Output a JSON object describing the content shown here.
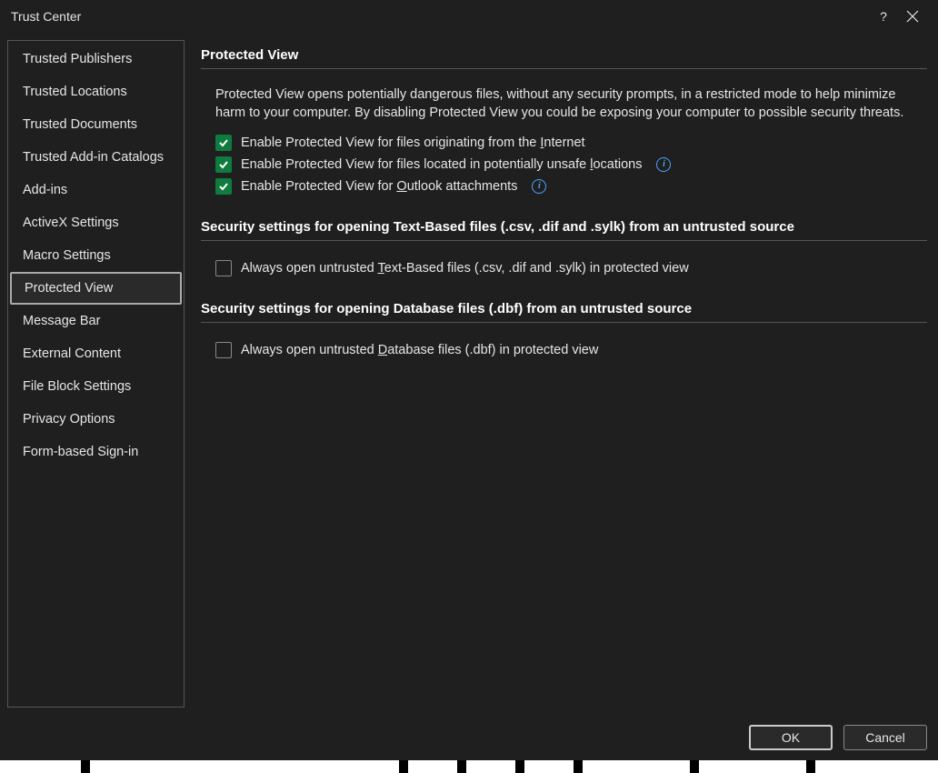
{
  "window": {
    "title": "Trust Center"
  },
  "sidebar": {
    "items": [
      {
        "label": "Trusted Publishers",
        "selected": false
      },
      {
        "label": "Trusted Locations",
        "selected": false
      },
      {
        "label": "Trusted Documents",
        "selected": false
      },
      {
        "label": "Trusted Add-in Catalogs",
        "selected": false
      },
      {
        "label": "Add-ins",
        "selected": false
      },
      {
        "label": "ActiveX Settings",
        "selected": false
      },
      {
        "label": "Macro Settings",
        "selected": false
      },
      {
        "label": "Protected View",
        "selected": true
      },
      {
        "label": "Message Bar",
        "selected": false
      },
      {
        "label": "External Content",
        "selected": false
      },
      {
        "label": "File Block Settings",
        "selected": false
      },
      {
        "label": "Privacy Options",
        "selected": false
      },
      {
        "label": "Form-based Sign-in",
        "selected": false
      }
    ]
  },
  "main": {
    "section1": {
      "title": "Protected View",
      "description": "Protected View opens potentially dangerous files, without any security prompts, in a restricted mode to help minimize harm to your computer. By disabling Protected View you could be exposing your computer to possible security threats.",
      "checkboxes": [
        {
          "label_pre": "Enable Protected View for files originating from the ",
          "underline": "I",
          "label_post": "nternet",
          "checked": true,
          "info": false
        },
        {
          "label_pre": "Enable Protected View for files located in potentially unsafe ",
          "underline": "l",
          "label_post": "ocations",
          "checked": true,
          "info": true
        },
        {
          "label_pre": "Enable Protected View for ",
          "underline": "O",
          "label_post": "utlook attachments",
          "checked": true,
          "info": true
        }
      ]
    },
    "section2": {
      "title": "Security settings for opening Text-Based files (.csv, .dif and .sylk) from an untrusted source",
      "checkbox": {
        "label_pre": "Always open untrusted ",
        "underline": "T",
        "label_post": "ext-Based files (.csv, .dif and .sylk) in protected view",
        "checked": false
      }
    },
    "section3": {
      "title": "Security settings for opening Database files (.dbf) from an untrusted source",
      "checkbox": {
        "label_pre": "Always open untrusted ",
        "underline": "D",
        "label_post": "atabase files (.dbf) in protected view",
        "checked": false
      }
    }
  },
  "footer": {
    "ok": "OK",
    "cancel": "Cancel"
  }
}
